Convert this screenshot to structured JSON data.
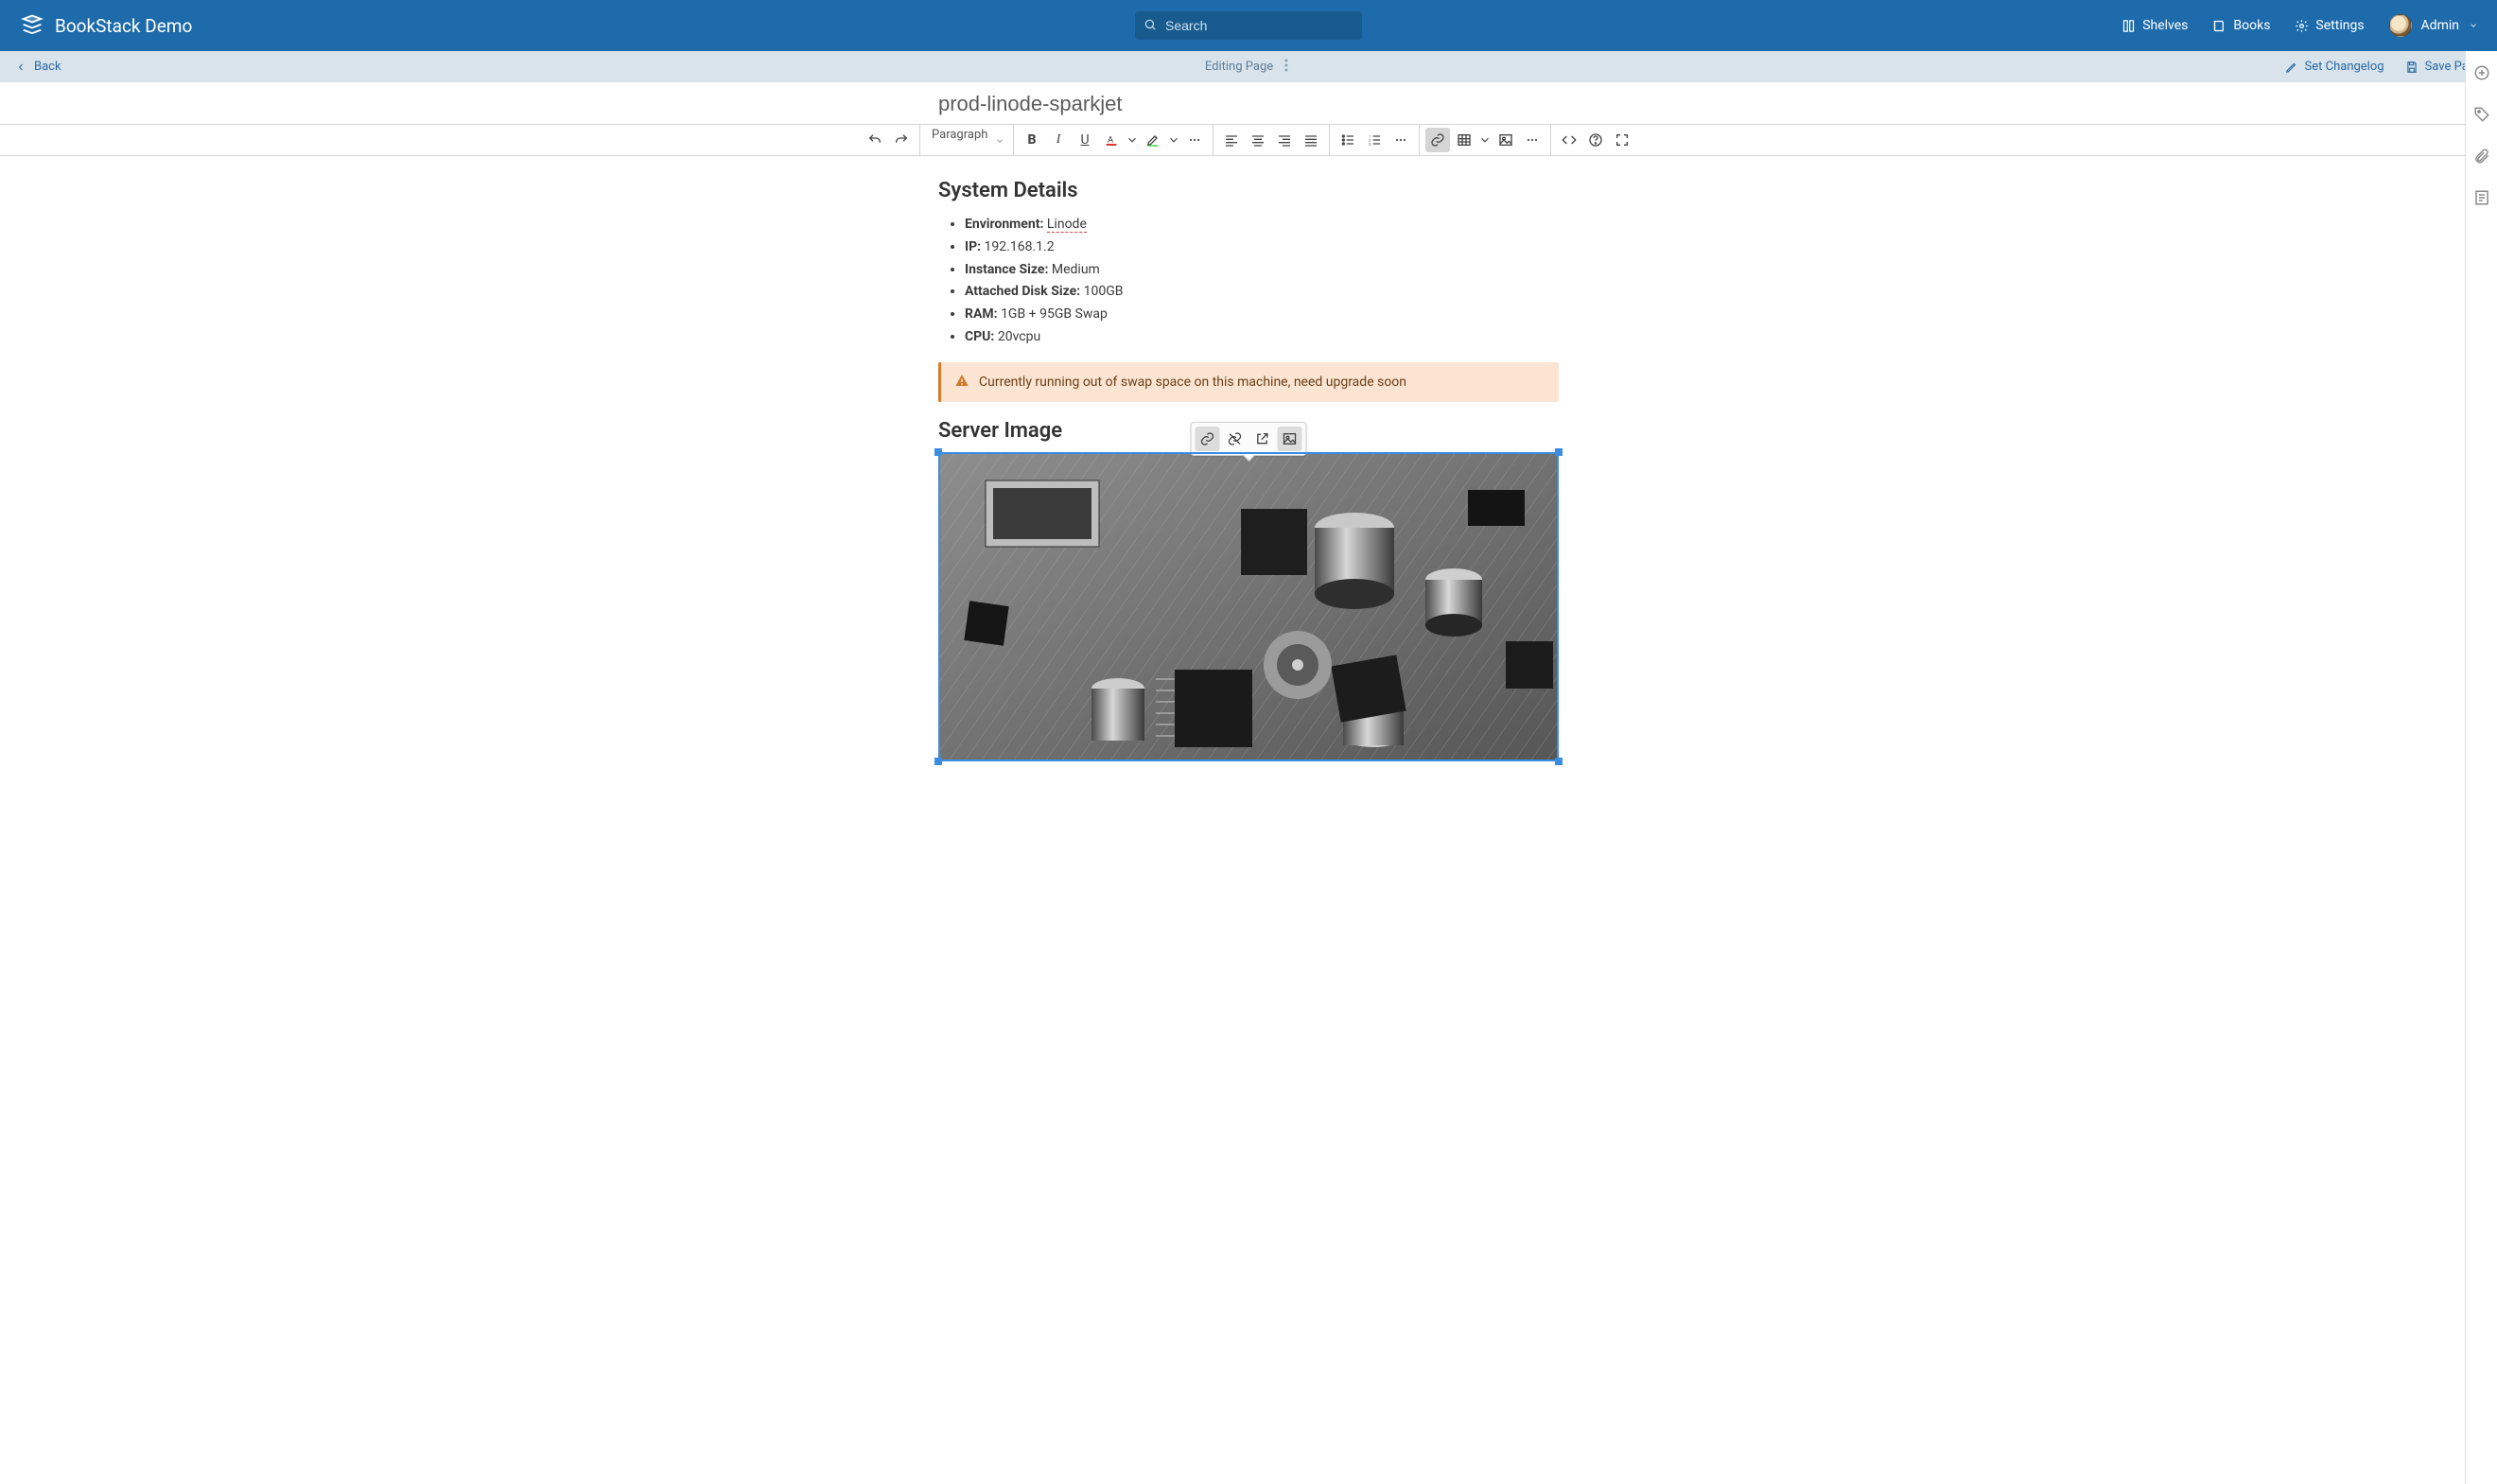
{
  "brand": "BookStack Demo",
  "search": {
    "placeholder": "Search"
  },
  "nav": {
    "shelves": "Shelves",
    "books": "Books",
    "settings": "Settings",
    "user": "Admin"
  },
  "subheader": {
    "back": "Back",
    "center": "Editing Page",
    "set_changelog": "Set Changelog",
    "save": "Save Page"
  },
  "page": {
    "title": "prod-linode-sparkjet"
  },
  "toolbar": {
    "block": "Paragraph"
  },
  "content": {
    "h_details": "System Details",
    "details": [
      {
        "k": "Environment:",
        "v": "Linode",
        "link": true
      },
      {
        "k": "IP:",
        "v": "192.168.1.2"
      },
      {
        "k": "Instance Size:",
        "v": "Medium"
      },
      {
        "k": "Attached Disk Size:",
        "v": "100GB"
      },
      {
        "k": "RAM:",
        "v": "1GB + 95GB Swap"
      },
      {
        "k": "CPU:",
        "v": "20vcpu"
      }
    ],
    "callout": "Currently running out of swap space on this machine, need upgrade soon",
    "h_image": "Server Image"
  }
}
